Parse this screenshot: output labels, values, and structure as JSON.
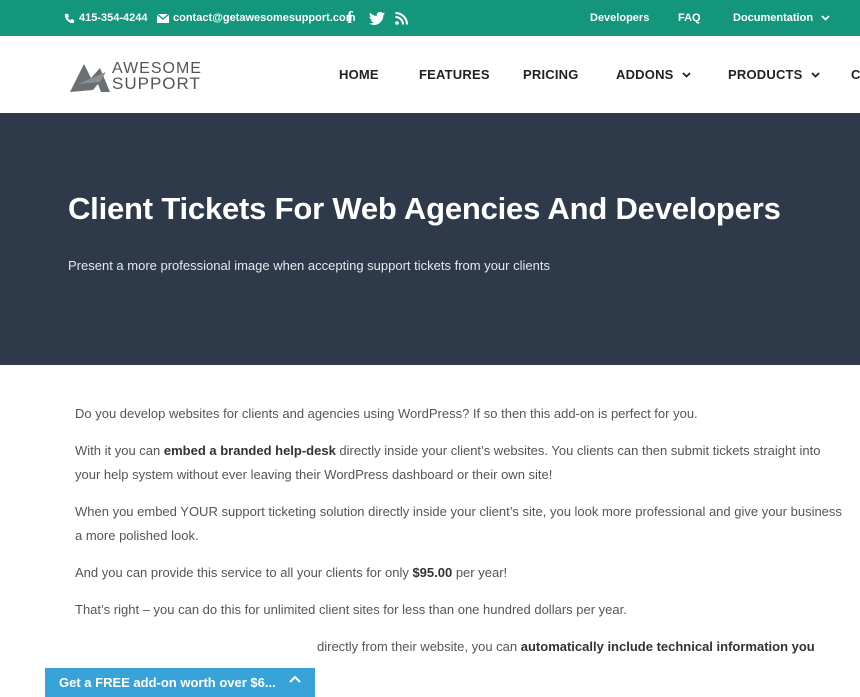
{
  "topbar": {
    "phone": "415-354-4244",
    "email": "contact@getawesomesupport.com",
    "links": [
      "Developers",
      "FAQ",
      "Documentation"
    ]
  },
  "logo": {
    "line1": "AWESOME",
    "line2": "SUPPORT"
  },
  "nav": [
    "HOME",
    "FEATURES",
    "PRICING",
    "ADDONS",
    "PRODUCTS",
    "C"
  ],
  "hero": {
    "title": "Client Tickets For Web Agencies And Developers",
    "subtitle": "Present a more professional image when accepting support tickets from your clients"
  },
  "content": {
    "p1": "Do you develop websites for clients and agencies using WordPress?  If so then this add-on is perfect for you.",
    "p2_a": "With it you can ",
    "p2_b": "embed a branded help-desk",
    "p2_c": " directly inside your client’s websites.  You clients can then submit tickets straight into your help system without ever leaving their WordPress dashboard or their own site!",
    "p3": "When you embed YOUR support ticketing solution directly inside your client’s site, you look more professional and give your business a more polished look.",
    "p4_a": "And you can provide this service to all your clients for only ",
    "p4_b": "$95.00",
    "p4_c": " per year!",
    "p5": "That’s right – you can do this for unlimited client sites for less than one hundred dollars per year.",
    "p6_a": "directly from their website, you can ",
    "p6_b": "automatically include technical information you"
  },
  "cta": {
    "label": "Get a FREE add-on worth over $6..."
  },
  "colors": {
    "topbar": "#13967c",
    "hero": "#2e3a4a",
    "cta": "#38a3d8"
  }
}
